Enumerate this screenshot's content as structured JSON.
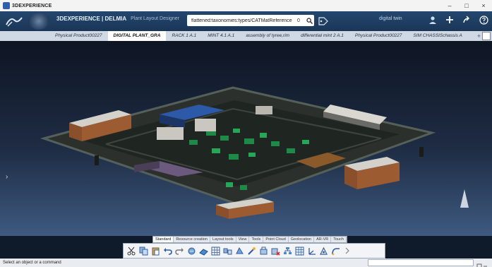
{
  "window": {
    "title": "3DEXPERIENCE",
    "controls": [
      "–",
      "□",
      "×"
    ]
  },
  "header": {
    "brand_primary": "3DEXPERIENCE | DELMIA",
    "brand_secondary": "Plant Layout Designer",
    "search": {
      "query": "flattened:taxonomies:types/CATMatReference",
      "count": "0"
    },
    "user_label": "digital twin"
  },
  "tabs": [
    {
      "label": "Physical Product00227",
      "active": false
    },
    {
      "label": "DIGITAL PLANT_GRA",
      "active": true
    },
    {
      "label": "RACK 1 A.1",
      "active": false
    },
    {
      "label": "MINT 4.1 A.1",
      "active": false
    },
    {
      "label": "assembly of tyree,rim",
      "active": false
    },
    {
      "label": "differential mint 2 A.1",
      "active": false
    },
    {
      "label": "Physical Product00227",
      "active": false
    },
    {
      "label": "SIM CHASSISchassis A",
      "active": false
    }
  ],
  "toolbar": {
    "tabs": [
      {
        "label": "Standard",
        "active": true
      },
      {
        "label": "Resource creation",
        "active": false
      },
      {
        "label": "Layout tools",
        "active": false
      },
      {
        "label": "View",
        "active": false
      },
      {
        "label": "Tools",
        "active": false
      },
      {
        "label": "Point Cloud",
        "active": false
      },
      {
        "label": "Geolocation",
        "active": false
      },
      {
        "label": "AR-VR",
        "active": false
      },
      {
        "label": "Touch",
        "active": false
      }
    ],
    "icons": [
      "cut-icon",
      "copy-icon",
      "paste-icon",
      "undo-icon",
      "redo-icon",
      "resource-icon",
      "area-icon",
      "grid-icon",
      "flow-icon",
      "group-icon",
      "measure-icon",
      "snap-icon",
      "delete-icon",
      "hierarchy-icon",
      "table-icon",
      "axis-icon",
      "compass-tool-icon",
      "route-icon"
    ]
  },
  "status": {
    "message": "Select an object or a command"
  },
  "colors": {
    "accent": "#1f3f66",
    "floor": "#2a2f2c",
    "wall": "#3a3f3b",
    "roof_blue": "#2d5aa8",
    "building_brick": "#8a4f2b",
    "machinery_green": "#1e8a48"
  }
}
